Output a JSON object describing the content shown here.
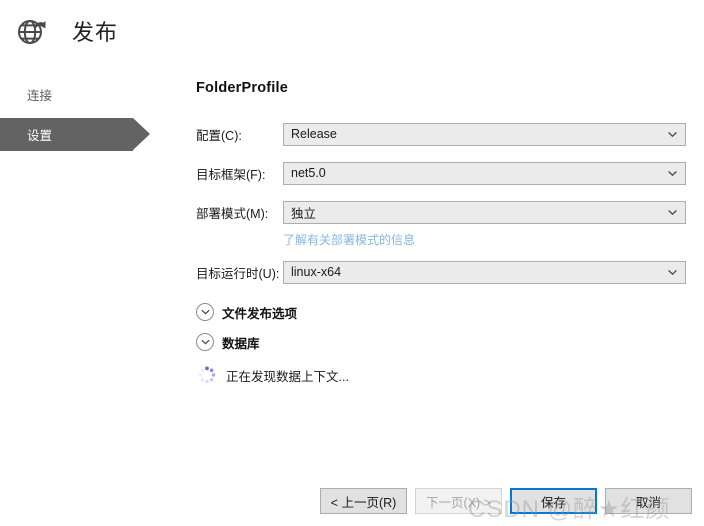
{
  "window": {
    "title": "发布",
    "icon": "globe-publish-icon"
  },
  "sidebar": {
    "items": [
      {
        "label": "连接",
        "selected": false
      },
      {
        "label": "设置",
        "selected": true
      }
    ]
  },
  "main": {
    "profile_title": "FolderProfile",
    "fields": [
      {
        "label": "配置(C):",
        "value": "Release"
      },
      {
        "label": "目标框架(F):",
        "value": "net5.0"
      },
      {
        "label": "部署模式(M):",
        "value": "独立"
      },
      {
        "label": "目标运行时(U):",
        "value": "linux-x64"
      }
    ],
    "deployment_hint_link": "了解有关部署模式的信息",
    "expanders": [
      {
        "label": "文件发布选项",
        "expanded": false
      },
      {
        "label": "数据库",
        "expanded": false
      }
    ],
    "status": {
      "text": "正在发现数据上下文...",
      "icon": "loading-spinner-icon"
    }
  },
  "footer": {
    "buttons": [
      {
        "label": "< 上一页(R)",
        "state": "enabled"
      },
      {
        "label": "下一页(X) >",
        "state": "disabled"
      },
      {
        "label": "保存",
        "state": "focused"
      },
      {
        "label": "取消",
        "state": "enabled"
      }
    ]
  },
  "watermark": {
    "text": "CSDN @醉★红颜"
  },
  "colors": {
    "accent": "#0078d7",
    "nav_selected_bg": "#636363",
    "combo_bg": "#ebebeb",
    "combo_border": "#adadad",
    "link": "#8ab6e0",
    "spinner": "#7a6fd0"
  }
}
